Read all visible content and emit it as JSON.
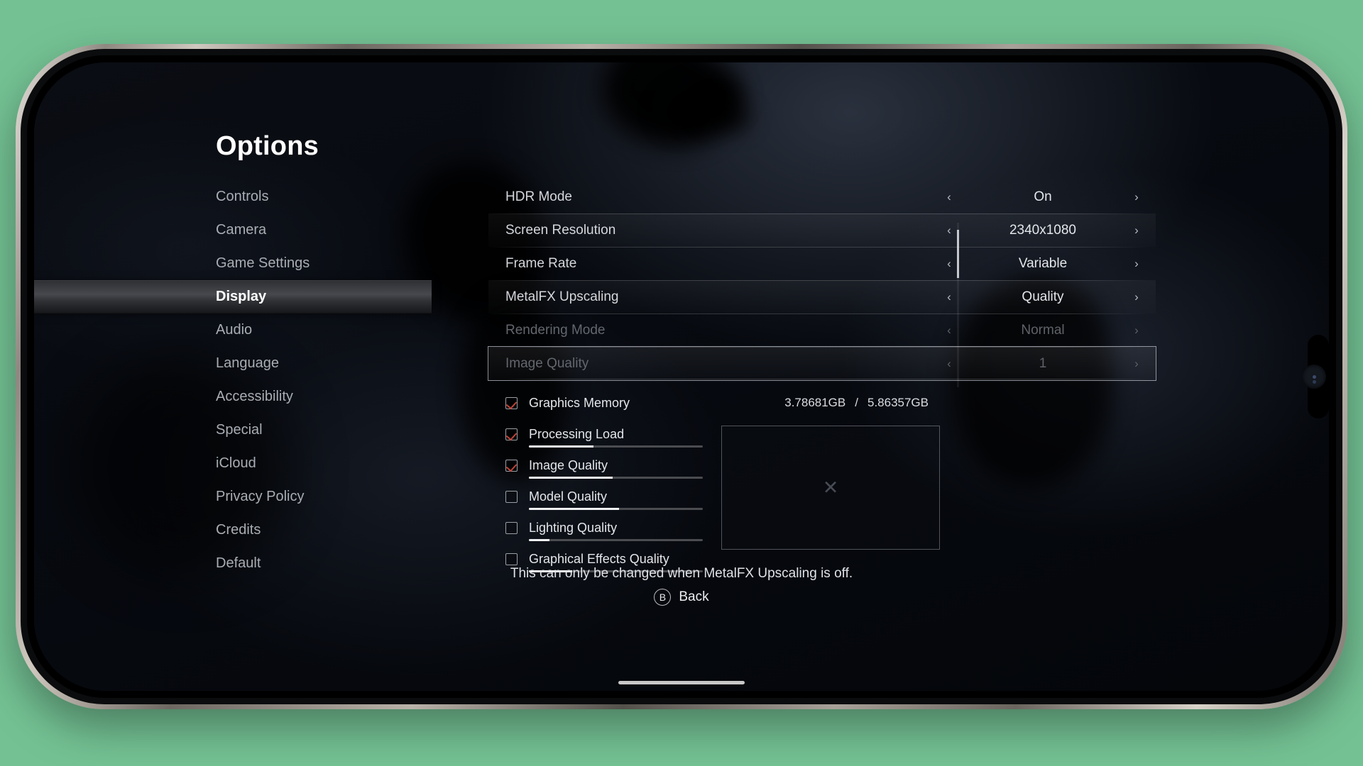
{
  "screen": {
    "title": "Options"
  },
  "sidebar": {
    "items": [
      {
        "label": "Controls",
        "selected": false
      },
      {
        "label": "Camera",
        "selected": false
      },
      {
        "label": "Game Settings",
        "selected": false
      },
      {
        "label": "Display",
        "selected": true
      },
      {
        "label": "Audio",
        "selected": false
      },
      {
        "label": "Language",
        "selected": false
      },
      {
        "label": "Accessibility",
        "selected": false
      },
      {
        "label": "Special",
        "selected": false
      },
      {
        "label": "iCloud",
        "selected": false
      },
      {
        "label": "Privacy Policy",
        "selected": false
      },
      {
        "label": "Credits",
        "selected": false
      },
      {
        "label": "Default",
        "selected": false
      }
    ]
  },
  "settings": {
    "rows": [
      {
        "label": "HDR Mode",
        "value": "On",
        "left_arrow": "‹",
        "right_arrow": "›",
        "disabled": false,
        "focused": false
      },
      {
        "label": "Screen Resolution",
        "value": "2340x1080",
        "left_arrow": "‹",
        "right_arrow": "›",
        "disabled": false,
        "focused": false
      },
      {
        "label": "Frame Rate",
        "value": "Variable",
        "left_arrow": "‹",
        "right_arrow": "›",
        "disabled": false,
        "focused": false
      },
      {
        "label": "MetalFX Upscaling",
        "value": "Quality",
        "left_arrow": "‹",
        "right_arrow": "›",
        "disabled": false,
        "focused": false
      },
      {
        "label": "Rendering Mode",
        "value": "Normal",
        "left_arrow": "‹",
        "right_arrow": "›",
        "disabled": true,
        "focused": false
      },
      {
        "label": "Image Quality",
        "value": "1",
        "left_arrow": "‹",
        "right_arrow": "›",
        "disabled": true,
        "focused": true
      }
    ]
  },
  "stats": {
    "memory": {
      "used": "3.78681GB",
      "separator": "/",
      "total": "5.86357GB"
    },
    "items": [
      {
        "label": "Graphics Memory",
        "checked": true,
        "bar": null
      },
      {
        "label": "Processing Load",
        "checked": true,
        "bar": 37
      },
      {
        "label": "Image Quality",
        "checked": true,
        "bar": 48
      },
      {
        "label": "Model Quality",
        "checked": false,
        "bar": 52
      },
      {
        "label": "Lighting Quality",
        "checked": false,
        "bar": 12
      },
      {
        "label": "Graphical Effects Quality",
        "checked": false,
        "bar": 25
      }
    ]
  },
  "preview": {
    "placeholder": "✕"
  },
  "footer": {
    "hint": "This can only be changed when MetalFX Upscaling is off.",
    "back_button_glyph": "B",
    "back_label": "Back"
  },
  "colors": {
    "accent_check": "#c0453a",
    "text_primary": "#e9eaec",
    "text_muted": "#a9adb4",
    "text_disabled": "#5e6268",
    "bar_fill": "#f0f1f3"
  }
}
